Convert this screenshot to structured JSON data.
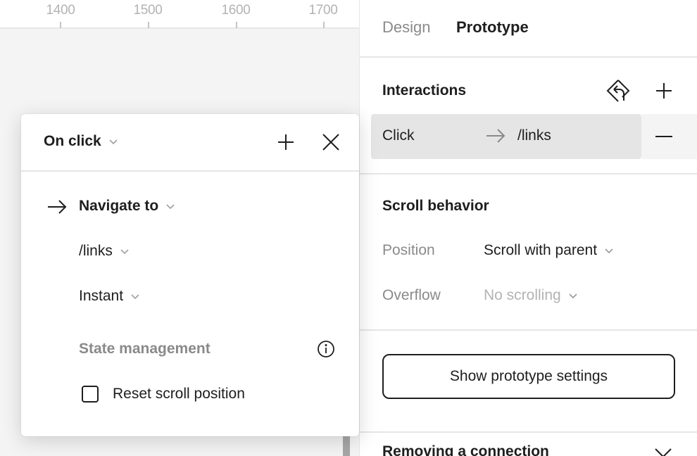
{
  "ruler": {
    "ticks": [
      "1400",
      "1500",
      "1600",
      "1700"
    ]
  },
  "panel": {
    "tabs": [
      {
        "label": "Design",
        "active": false
      },
      {
        "label": "Prototype",
        "active": true
      }
    ],
    "interactions": {
      "title": "Interactions",
      "icons": {
        "flow": "flow-starting-point-icon",
        "add": "plus-icon"
      },
      "items": [
        {
          "trigger": "Click",
          "destination": "/links",
          "remove_icon": "minus-icon"
        }
      ]
    },
    "scroll_behavior": {
      "title": "Scroll behavior",
      "position_label": "Position",
      "position_value": "Scroll with parent",
      "overflow_label": "Overflow",
      "overflow_value": "No scrolling"
    },
    "settings_button": "Show prototype settings",
    "removing_connection": {
      "title": "Removing a connection",
      "icon": "chevron-down-icon"
    }
  },
  "popover": {
    "trigger": "On click",
    "action": "Navigate to",
    "destination": "/links",
    "animation": "Instant",
    "state_management_label": "State management",
    "reset_scroll_label": "Reset scroll position",
    "reset_scroll_checked": false
  },
  "colors": {
    "text": "#1e1e1e",
    "muted": "#8a8a8a",
    "disabled": "#b3b3b3",
    "row_selected": "#e5e5e5",
    "canvas": "#f4f4f4",
    "divider": "#e6e6e6"
  }
}
